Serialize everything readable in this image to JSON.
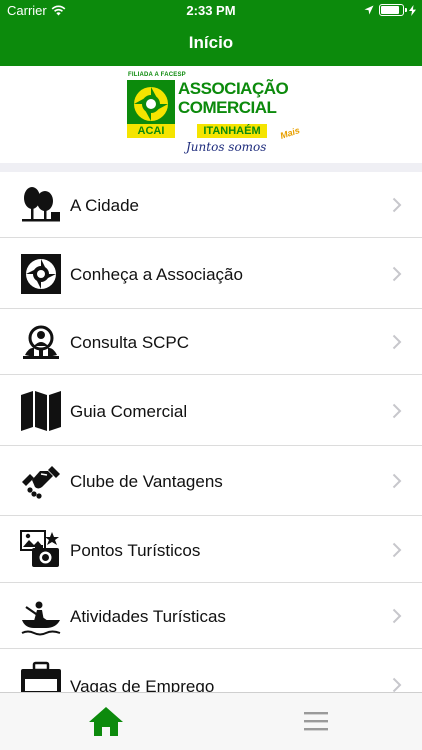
{
  "status_bar": {
    "carrier": "Carrier",
    "time": "2:33 PM",
    "battery_level": 0.85
  },
  "nav": {
    "title": "Início"
  },
  "logo": {
    "top_text": "FILIADA A FACESP",
    "line1": "ASSOCIAÇÃO",
    "line2": "COMERCIAL",
    "acronym": "ACAI",
    "city": "ITANHAÉM",
    "tagline": "Juntos somos",
    "tagline_accent": "Mais"
  },
  "menu": {
    "items": [
      {
        "label": "A Cidade",
        "icon": "city-trees-icon"
      },
      {
        "label": "Conheça a Associação",
        "icon": "association-logo-icon"
      },
      {
        "label": "Consulta SCPC",
        "icon": "person-search-icon"
      },
      {
        "label": "Guia Comercial",
        "icon": "map-icon"
      },
      {
        "label": "Clube de Vantagens",
        "icon": "handshake-icon"
      },
      {
        "label": "Pontos Turísticos",
        "icon": "tourist-spots-icon"
      },
      {
        "label": "Atividades Turísticas",
        "icon": "canoe-icon"
      },
      {
        "label": "Vagas de Emprego",
        "icon": "briefcase-icon"
      }
    ]
  },
  "tabbar": {
    "tabs": [
      {
        "icon": "home-icon",
        "active": true
      },
      {
        "icon": "menu-icon",
        "active": false
      }
    ],
    "accent_color": "#0c8a0c",
    "inactive_color": "#9a9a9a"
  }
}
